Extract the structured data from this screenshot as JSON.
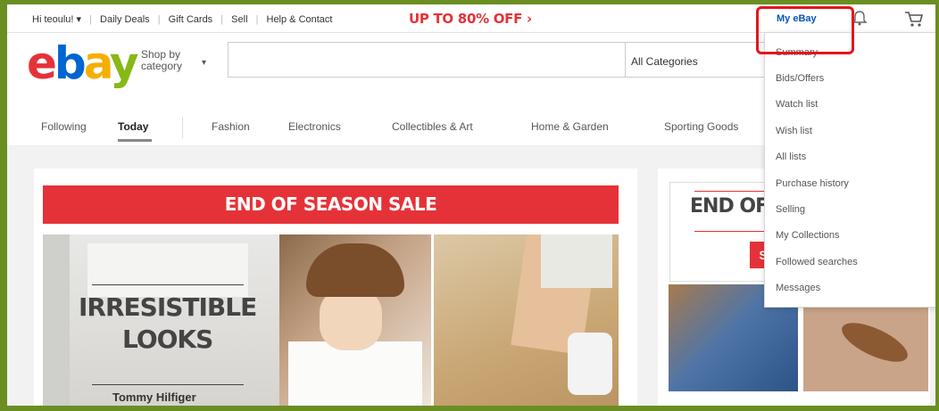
{
  "topbar": {
    "greeting": "Hi teoulu! ▾",
    "links": [
      "Daily Deals",
      "Gift Cards",
      "Sell",
      "Help & Contact"
    ],
    "promo": "UP TO 80% OFF ›",
    "myebay": "My eBay"
  },
  "logo": {
    "e": "e",
    "b": "b",
    "a": "a",
    "y": "y"
  },
  "header": {
    "shop_by_line1": "Shop by",
    "shop_by_line2": "category",
    "caret": "▾",
    "search_placeholder": "",
    "category_select": "All Categories"
  },
  "nav": {
    "items": [
      "Following",
      "Today",
      "Fashion",
      "Electronics",
      "Collectibles & Art",
      "Home & Garden",
      "Sporting Goods"
    ],
    "active": "Today"
  },
  "main": {
    "banner": "END OF SEASON SALE",
    "headline_line1": "IRRESISTIBLE",
    "headline_line2": "LOOKS",
    "brand": "Tommy Hilfiger"
  },
  "right_panel": {
    "title": "END OF",
    "button": "S"
  },
  "dropdown": {
    "items": [
      "Summary",
      "Bids/Offers",
      "Watch list",
      "Wish list",
      "All lists",
      "Purchase history",
      "Selling",
      "My Collections",
      "Followed searches",
      "Messages"
    ]
  },
  "colors": {
    "ebay_red": "#e53238",
    "ebay_blue": "#0064d2",
    "ebay_yellow": "#f5af02",
    "ebay_green": "#86b817",
    "highlight": "#e8141b"
  },
  "icons": [
    "bell-icon",
    "cart-icon"
  ]
}
